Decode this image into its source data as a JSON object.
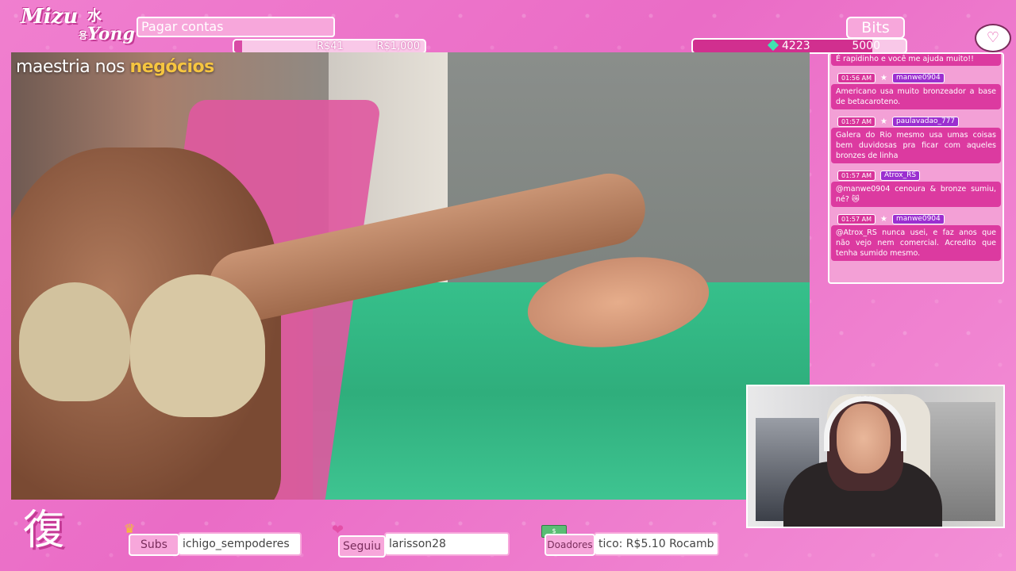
{
  "logo": {
    "line1": "Mizu",
    "kanji1": "水",
    "kanji2": "용",
    "line2": "Yong"
  },
  "goal": {
    "label": "Pagar contas",
    "current": "R$41",
    "target": "R$1,000",
    "progress": 0.041
  },
  "bits": {
    "label": "Bits",
    "current": "4223",
    "target": "5000",
    "progress": 0.845
  },
  "video": {
    "caption_part1": "maestria nos ",
    "caption_part2": "negócios"
  },
  "chat": {
    "first_line": "É rapidinho e você me ajuda muito!!",
    "messages": [
      {
        "time": "01:56 AM",
        "user": "manwe0904",
        "text": "Americano usa muito bronzeador a base de betacaroteno."
      },
      {
        "time": "01:57 AM",
        "user": "paulavadao_777",
        "text": "Galera do Rio mesmo usa umas coisas bem duvidosas pra ficar com aqueles bronzes de linha"
      },
      {
        "time": "01:57 AM",
        "user": "Atrox_RS",
        "text": "@manwe0904 cenoura & bronze sumiu, né? 😿"
      },
      {
        "time": "01:57 AM",
        "user": "manwe0904",
        "text": "@Atrox_RS nunca usei, e faz anos que não vejo nem comercial. Acredito que tenha sumido mesmo."
      }
    ]
  },
  "bottom_logo": "復",
  "subs": {
    "label": "Subs",
    "value": "ichigo_sempoderes"
  },
  "follow": {
    "label": "Seguiu",
    "value": "larisson28"
  },
  "donors": {
    "label": "Doadores",
    "value": "tico: R$5.10    Rocamb"
  },
  "colors": {
    "accent": "#dc3aa0",
    "panel": "#f7a7db",
    "background": "#ea6cc6"
  }
}
